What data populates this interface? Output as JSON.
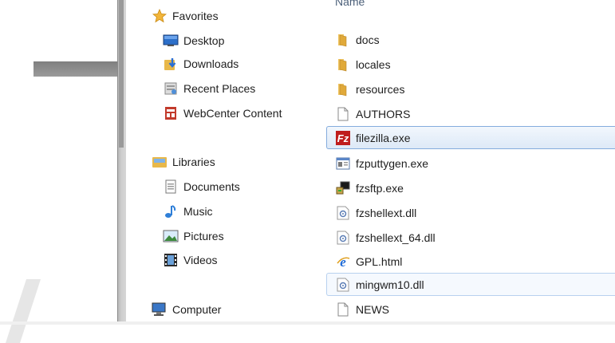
{
  "nav": {
    "favorites": {
      "label": "Favorites",
      "icon": "star-icon"
    },
    "favorite_items": [
      {
        "label": "Desktop",
        "icon": "desktop-icon"
      },
      {
        "label": "Downloads",
        "icon": "downloads-icon"
      },
      {
        "label": "Recent Places",
        "icon": "recent-places-icon"
      },
      {
        "label": "WebCenter Content",
        "icon": "webcenter-icon"
      }
    ],
    "libraries": {
      "label": "Libraries",
      "icon": "libraries-icon"
    },
    "library_items": [
      {
        "label": "Documents",
        "icon": "documents-icon"
      },
      {
        "label": "Music",
        "icon": "music-icon"
      },
      {
        "label": "Pictures",
        "icon": "pictures-icon"
      },
      {
        "label": "Videos",
        "icon": "videos-icon"
      }
    ],
    "computer": {
      "label": "Computer",
      "icon": "computer-icon"
    }
  },
  "files": {
    "column_header": "Name",
    "items": [
      {
        "name": "docs",
        "icon": "folder-icon"
      },
      {
        "name": "locales",
        "icon": "folder-icon"
      },
      {
        "name": "resources",
        "icon": "folder-icon"
      },
      {
        "name": "AUTHORS",
        "icon": "file-icon"
      },
      {
        "name": "filezilla.exe",
        "icon": "filezilla-icon",
        "state": "selected"
      },
      {
        "name": "fzputtygen.exe",
        "icon": "app-window-icon"
      },
      {
        "name": "fzsftp.exe",
        "icon": "console-app-icon"
      },
      {
        "name": "fzshellext.dll",
        "icon": "dll-icon"
      },
      {
        "name": "fzshellext_64.dll",
        "icon": "dll-icon"
      },
      {
        "name": "GPL.html",
        "icon": "ie-html-icon"
      },
      {
        "name": "mingwm10.dll",
        "icon": "dll-icon",
        "state": "hover"
      },
      {
        "name": "NEWS",
        "icon": "file-icon"
      }
    ]
  },
  "colors": {
    "selection_border": "#84acdd",
    "header_text": "#4c607a",
    "folder": "#e8b84a"
  }
}
